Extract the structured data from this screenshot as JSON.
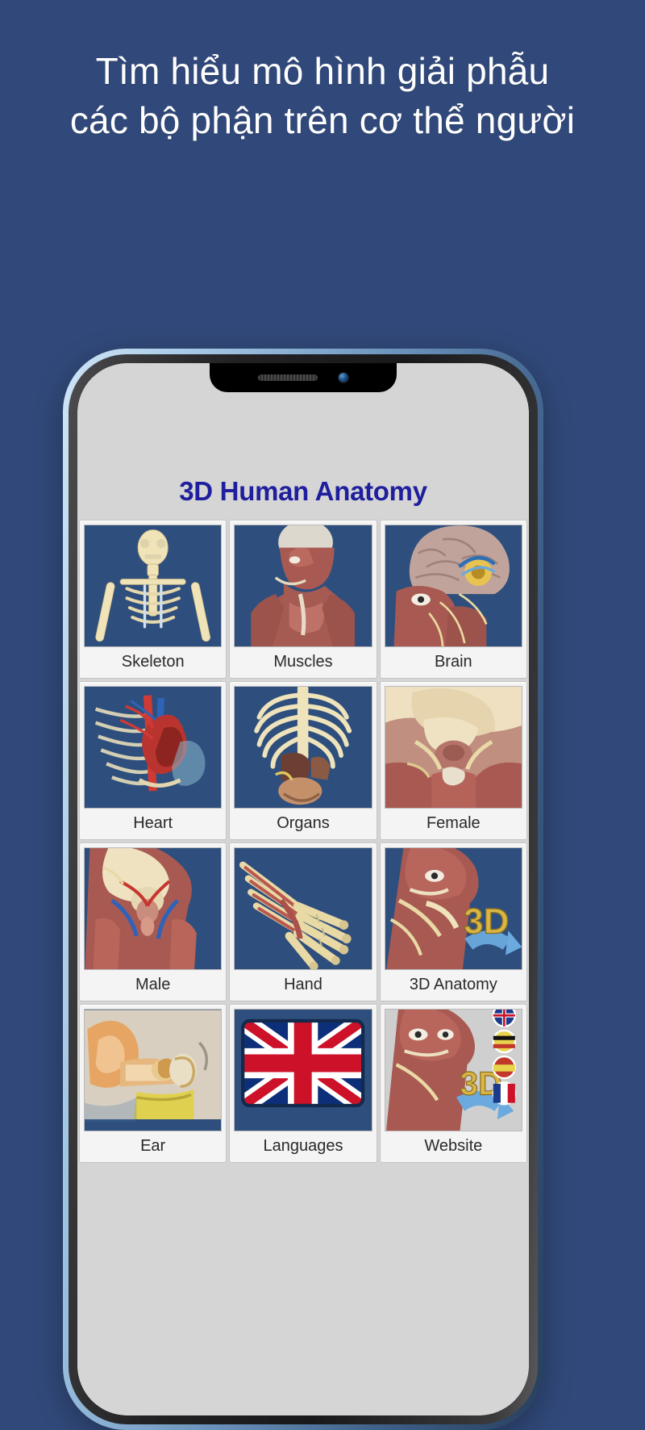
{
  "headline": {
    "line1": "Tìm hiểu mô hình giải phẫu",
    "line2": "các bộ phận trên cơ thể người",
    "color": "#ffffff"
  },
  "page": {
    "background_color": "#31497a"
  },
  "device": {
    "frame_color": "#9cc3e4",
    "bezel_color": "#1a1a1c",
    "notch": {
      "speaker_icon": "speaker-grille-icon",
      "camera_icon": "front-camera-icon"
    }
  },
  "app": {
    "title": "3D Human Anatomy",
    "title_color": "#1f1f9e",
    "screen_background": "#d5d5d5",
    "thumb_background": "#2e4f7d",
    "grid": [
      {
        "label": "Skeleton",
        "icon": "skeleton-thumbnail"
      },
      {
        "label": "Muscles",
        "icon": "muscles-thumbnail"
      },
      {
        "label": "Brain",
        "icon": "brain-thumbnail"
      },
      {
        "label": "Heart",
        "icon": "heart-thumbnail"
      },
      {
        "label": "Organs",
        "icon": "organs-thumbnail"
      },
      {
        "label": "Female",
        "icon": "female-anatomy-thumbnail"
      },
      {
        "label": "Male",
        "icon": "male-anatomy-thumbnail"
      },
      {
        "label": "Hand",
        "icon": "hand-thumbnail"
      },
      {
        "label": "3D Anatomy",
        "icon": "3d-anatomy-thumbnail"
      },
      {
        "label": "Ear",
        "icon": "ear-thumbnail"
      },
      {
        "label": "Languages",
        "icon": "uk-flag-thumbnail"
      },
      {
        "label": "Website",
        "icon": "website-thumbnail"
      }
    ],
    "badges": {
      "three_d_label": "3D"
    }
  }
}
